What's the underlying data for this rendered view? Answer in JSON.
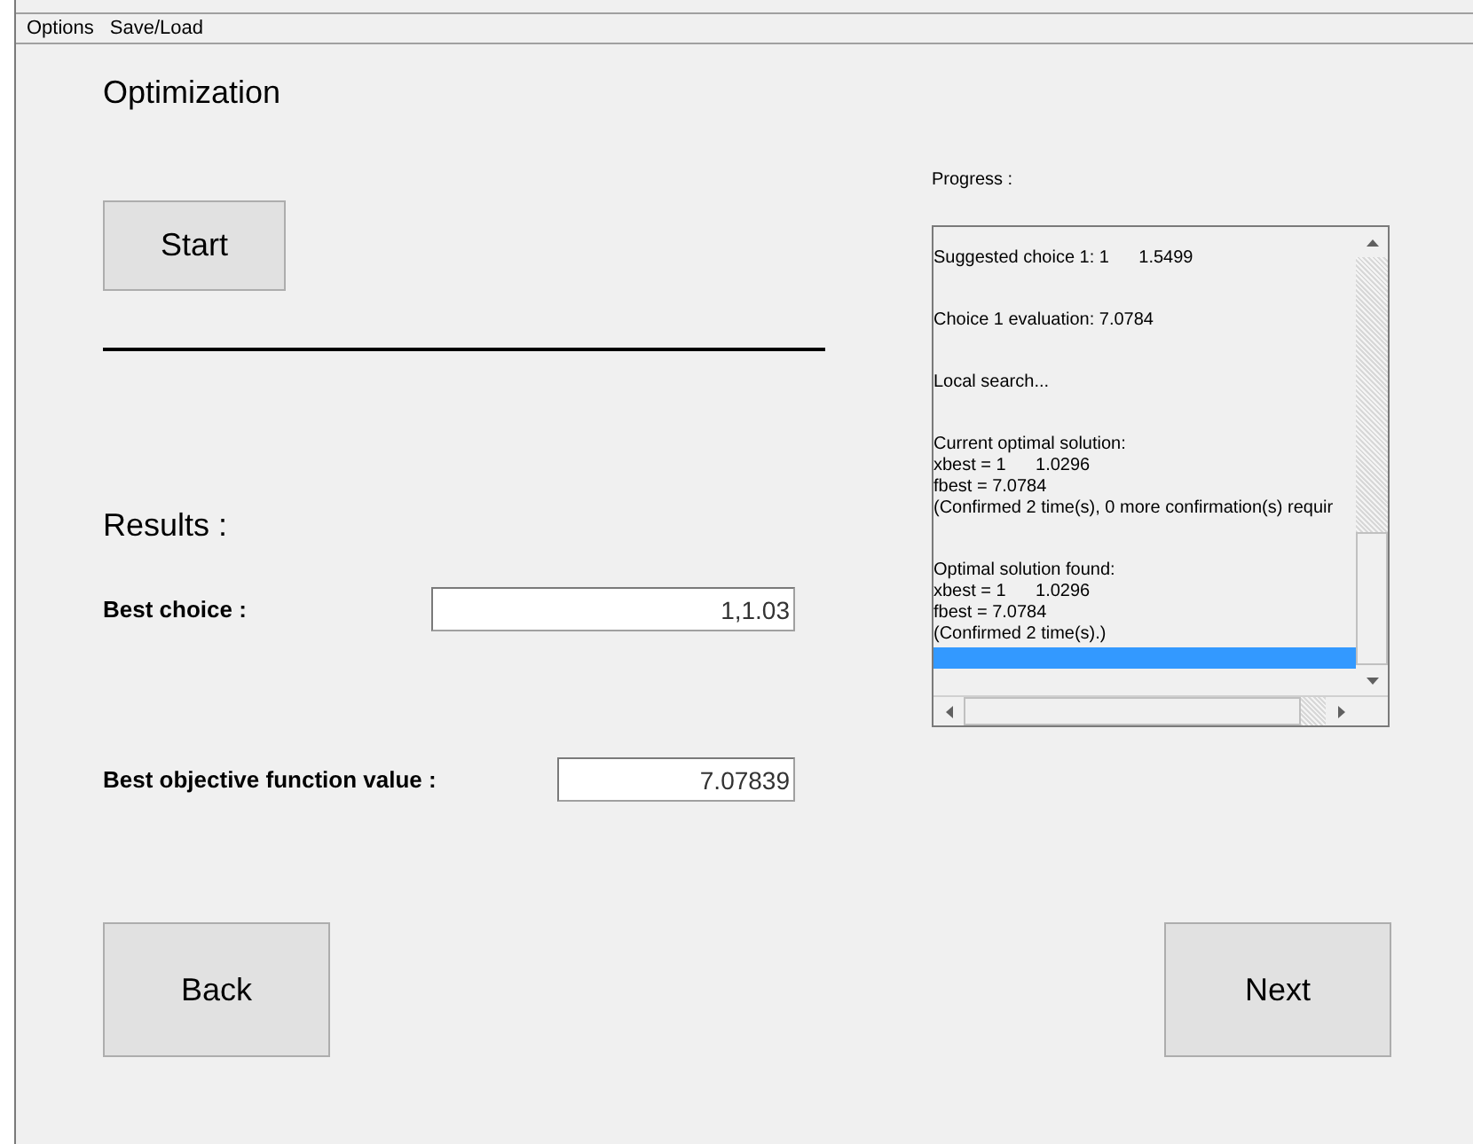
{
  "menu": [
    "Options",
    "Save/Load"
  ],
  "title": "Optimization",
  "start_button": "Start",
  "results_heading": "Results :",
  "fields": [
    {
      "label": "Best choice :",
      "value": "1,1.03"
    },
    {
      "label": "Best objective function value :",
      "value": "7.07839"
    }
  ],
  "progress": {
    "label": "Progress :",
    "entries": [
      {
        "lines": [
          "Suggested choice 1: 1      1.5499"
        ],
        "selected": false
      },
      {
        "lines": [
          "Choice 1 evaluation: 7.0784"
        ],
        "selected": false
      },
      {
        "lines": [
          "Local search..."
        ],
        "selected": false
      },
      {
        "lines": [
          "Current optimal solution:",
          "xbest = 1      1.0296",
          "fbest = 7.0784",
          "(Confirmed 2 time(s), 0 more confirmation(s) requir"
        ],
        "selected": false
      },
      {
        "lines": [
          "Optimal solution found:",
          "xbest = 1      1.0296",
          "fbest = 7.0784",
          "(Confirmed 2 time(s).)"
        ],
        "selected": false
      },
      {
        "selected": true
      }
    ]
  },
  "buttons": [
    "Back",
    "Next"
  ]
}
